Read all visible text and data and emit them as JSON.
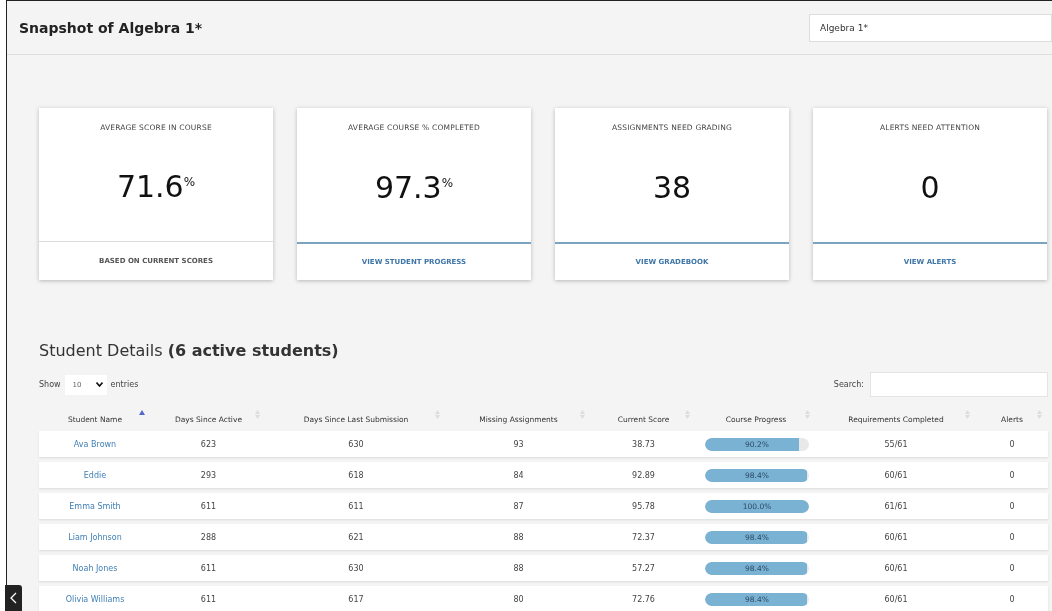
{
  "header": {
    "title": "Snapshot of Algebra 1*",
    "course_select": "Algebra 1*"
  },
  "cards": [
    {
      "label": "AVERAGE SCORE IN COURSE",
      "value": "71.6",
      "unit": "%",
      "footer": "BASED ON CURRENT SCORES",
      "kind": "note"
    },
    {
      "label": "AVERAGE COURSE % COMPLETED",
      "value": "97.3",
      "unit": "%",
      "footer": "VIEW STUDENT PROGRESS",
      "kind": "link"
    },
    {
      "label": "ASSIGNMENTS NEED GRADING",
      "value": "38",
      "footer": "VIEW GRADEBOOK",
      "kind": "link"
    },
    {
      "label": "ALERTS NEED ATTENTION",
      "value": "0",
      "footer": "VIEW ALERTS",
      "kind": "link"
    }
  ],
  "student_details": {
    "heading": "Student Details **(6 active students)**",
    "show_label": "Show",
    "page_size": "10",
    "entries_label": "entries",
    "search_label": "Search:",
    "columns": [
      {
        "label": "Student Name",
        "sorted": true
      },
      {
        "label": "Days Since Active",
        "sorted": false
      },
      {
        "label": "Days Since Last Submission",
        "sorted": false
      },
      {
        "label": "Missing Assignments",
        "sorted": false
      },
      {
        "label": "Current Score",
        "sorted": false
      },
      {
        "label": "Course Progress",
        "sorted": false
      },
      {
        "label": "Requirements Completed",
        "sorted": false
      },
      {
        "label": "Alerts",
        "sorted": false
      }
    ],
    "rows": [
      {
        "name": "Ava Brown",
        "days_active": "623",
        "days_submission": "630",
        "missing": "93",
        "score": "38.73",
        "progress": "90.2%",
        "level": 0.902,
        "requirements": "55/61",
        "alerts": "0"
      },
      {
        "name": "Eddie",
        "days_active": "293",
        "days_submission": "618",
        "missing": "84",
        "score": "92.89",
        "progress": "98.4%",
        "level": 0.984,
        "requirements": "60/61",
        "alerts": "0"
      },
      {
        "name": "Emma Smith",
        "days_active": "611",
        "days_submission": "611",
        "missing": "87",
        "score": "95.78",
        "progress": "100.0%",
        "level": 1.0,
        "requirements": "61/61",
        "alerts": "0"
      },
      {
        "name": "Liam Johnson",
        "days_active": "288",
        "days_submission": "621",
        "missing": "88",
        "score": "72.37",
        "progress": "98.4%",
        "level": 0.984,
        "requirements": "60/61",
        "alerts": "0"
      },
      {
        "name": "Noah Jones",
        "days_active": "611",
        "days_submission": "630",
        "missing": "88",
        "score": "57.27",
        "progress": "98.4%",
        "level": 0.984,
        "requirements": "60/61",
        "alerts": "0"
      },
      {
        "name": "Olivia Williams",
        "days_active": "611",
        "days_submission": "617",
        "missing": "80",
        "score": "72.76",
        "progress": "98.4%",
        "level": 0.984,
        "requirements": "60/61",
        "alerts": "0"
      }
    ]
  }
}
